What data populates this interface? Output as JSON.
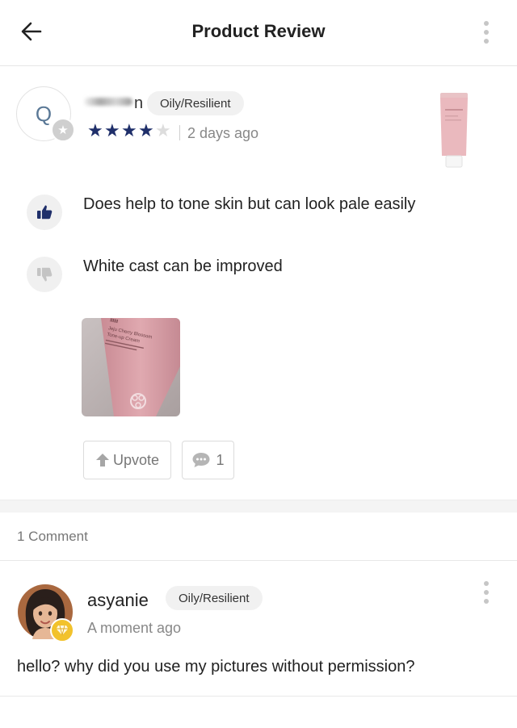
{
  "header": {
    "title": "Product Review",
    "back_icon": "back-arrow-icon",
    "menu_icon": "more-vertical-icon"
  },
  "review": {
    "avatar_letter": "Q",
    "username_visible_tail": "n",
    "skin_type": "Oily/Resilient",
    "rating": 4,
    "rating_max": 5,
    "time": "2 days ago",
    "pros": "Does help to tone skin but can look pale easily",
    "cons": "White cast can be improved",
    "photo_text": {
      "brand": "IIIIII",
      "product_line1": "Jeju Cherry Blossom",
      "product_line2": "Tone-up Cream"
    },
    "upvote_label": "Upvote",
    "comment_count": "1"
  },
  "comments": {
    "count_label": "1 Comment",
    "items": [
      {
        "author": "asyanie",
        "skin_type": "Oily/Resilient",
        "time": "A moment ago",
        "text": "hello? why did you use my pictures without permission?"
      }
    ]
  },
  "colors": {
    "star_filled": "#1f2f6a",
    "star_empty": "#dddddd",
    "thumbs_up": "#1f2f6a",
    "thumbs_down": "#c4c4c4",
    "badge_bg": "#f1f1f1",
    "muted_text": "#888888",
    "product_pink": "#e8b9bd"
  }
}
